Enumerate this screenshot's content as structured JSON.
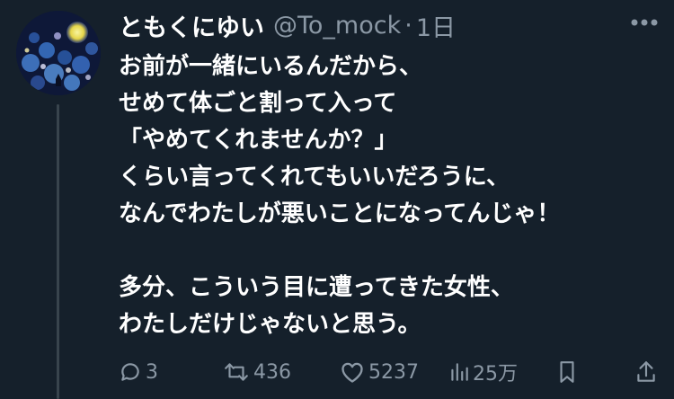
{
  "tweet": {
    "display_name": "ともくにゆい",
    "handle": "@To_mock",
    "separator": "·",
    "time": "1日",
    "lines": [
      "お前が一緒にいるんだから、",
      "せめて体ごと割って入って",
      "「やめてくれませんか？」",
      "くらい言ってくれてもいいだろうに、",
      "なんでわたしが悪いことになってんじゃ！",
      "",
      "多分、こういう目に遭ってきた女性、",
      "わたしだけじゃないと思う。"
    ],
    "actions": {
      "replies": "3",
      "retweets": "436",
      "likes": "5237",
      "views": "25万"
    }
  },
  "icons": {
    "more": "more-horizontal-icon",
    "reply": "reply-bubble-icon",
    "retweet": "retweet-icon",
    "like": "heart-icon",
    "views": "views-bar-chart-icon",
    "bookmark": "bookmark-icon",
    "share": "share-icon"
  },
  "colors": {
    "background": "#15202b",
    "text": "#ffffff",
    "secondary": "#8b98a5",
    "thread_line": "#38444d"
  }
}
